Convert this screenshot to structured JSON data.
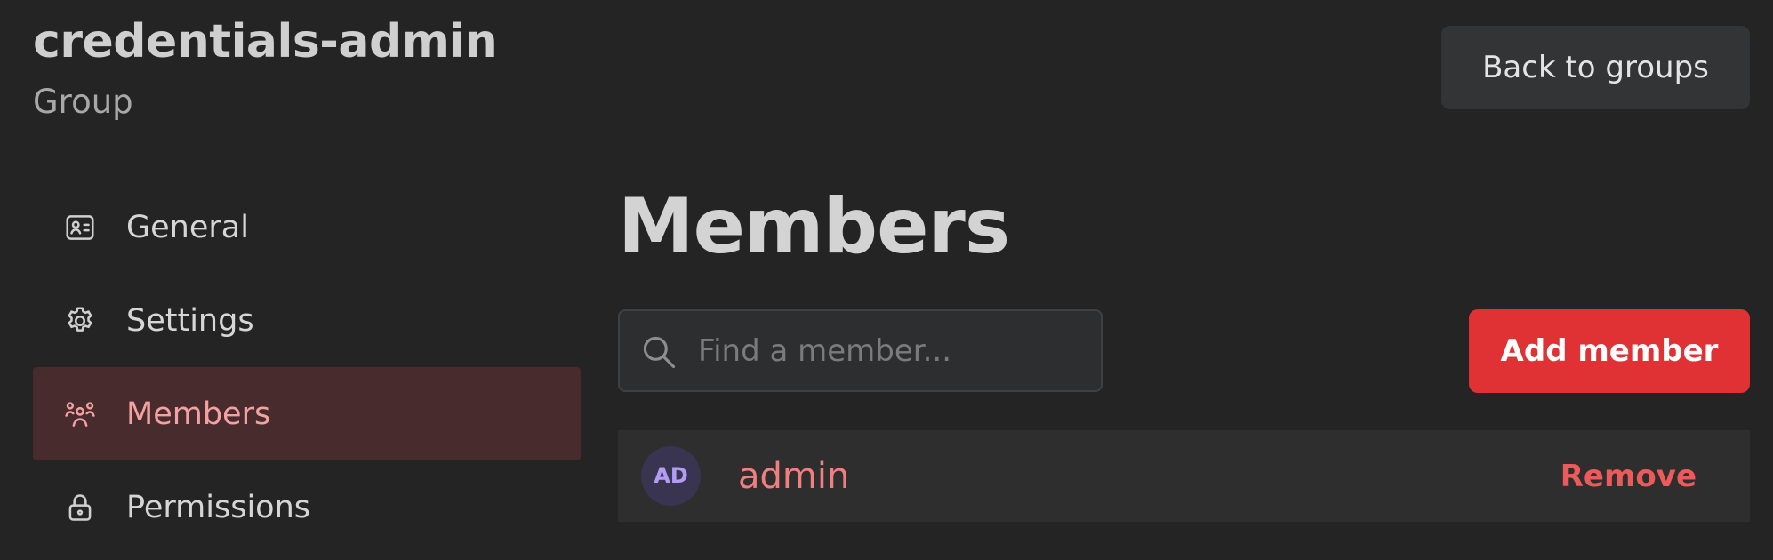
{
  "header": {
    "title": "credentials-admin",
    "subtitle": "Group",
    "back_label": "Back to groups"
  },
  "sidebar": {
    "items": [
      {
        "label": "General",
        "icon": "id-card-icon",
        "active": false
      },
      {
        "label": "Settings",
        "icon": "gear-icon",
        "active": false
      },
      {
        "label": "Members",
        "icon": "users-icon",
        "active": true
      },
      {
        "label": "Permissions",
        "icon": "lock-icon",
        "active": false
      }
    ]
  },
  "main": {
    "heading": "Members",
    "search": {
      "placeholder": "Find a member...",
      "value": "",
      "icon": "search-icon"
    },
    "add_label": "Add member",
    "members": [
      {
        "initials": "AD",
        "name": "admin",
        "action": "Remove"
      }
    ]
  },
  "colors": {
    "background": "#242424",
    "accent": "#e03134",
    "active_nav_bg": "#472b2d",
    "active_nav_text": "#f3a1a1",
    "member_link": "#f07f7f",
    "avatar_bg": "#393450",
    "avatar_text": "#b39cf3"
  }
}
